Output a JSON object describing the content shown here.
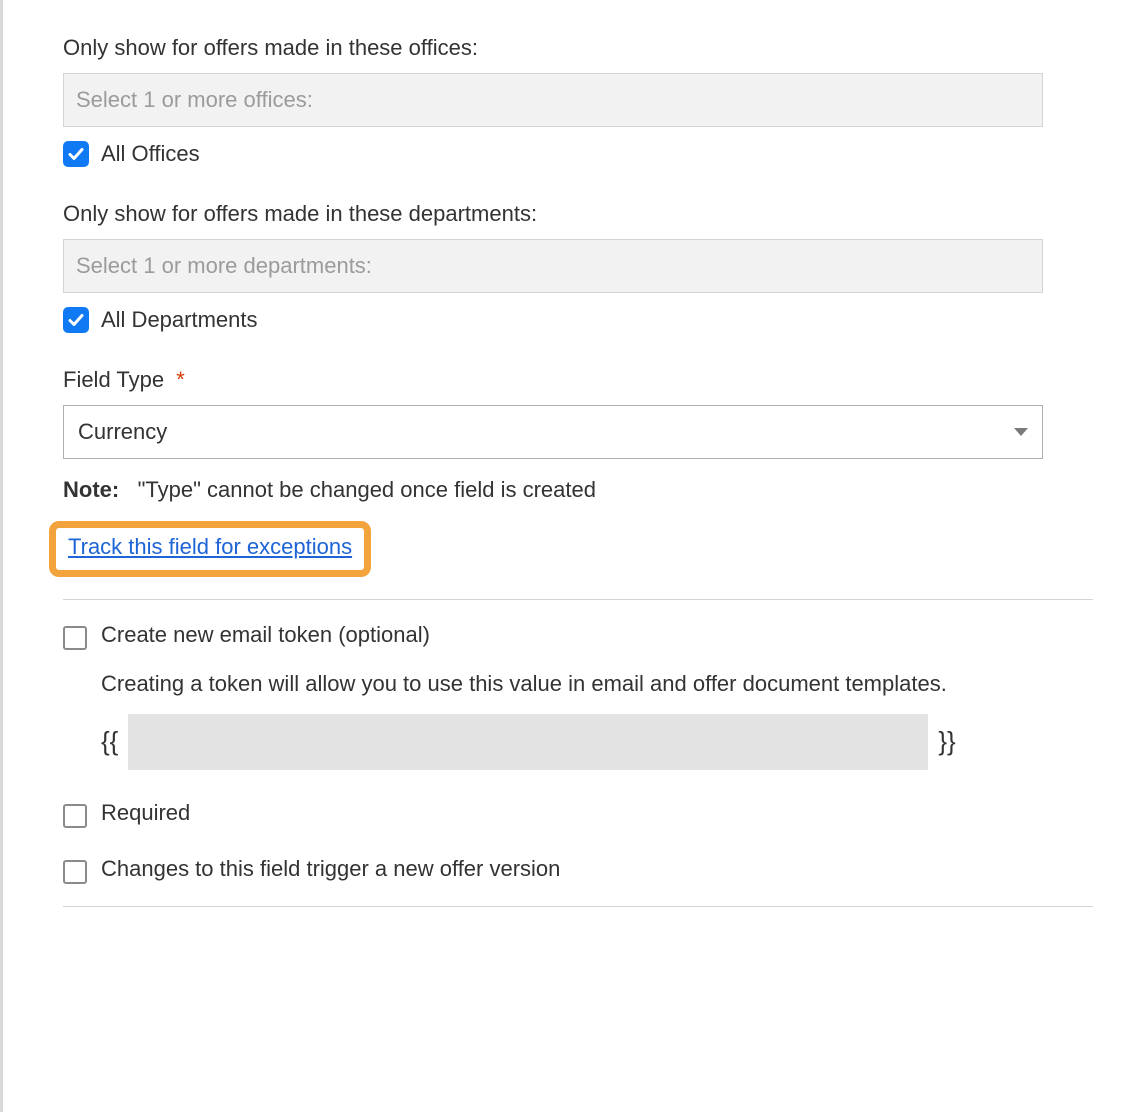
{
  "offices": {
    "label": "Only show for offers made in these offices:",
    "placeholder": "Select 1 or more offices:",
    "all_checked": true,
    "all_label": "All Offices"
  },
  "departments": {
    "label": "Only show for offers made in these departments:",
    "placeholder": "Select 1 or more departments:",
    "all_checked": true,
    "all_label": "All Departments"
  },
  "field_type": {
    "label": "Field Type",
    "required_mark": "*",
    "value": "Currency"
  },
  "note": {
    "prefix": "Note:",
    "text": "\"Type\" cannot be changed once field is created"
  },
  "track_link": "Track this field for exceptions",
  "token": {
    "checkbox_label": "Create new email token (optional)",
    "help": "Creating a token will allow you to use this value in email and offer document templates.",
    "open": "{{",
    "close": "}}",
    "value": ""
  },
  "required_option": "Required",
  "trigger_option": "Changes to this field trigger a new offer version"
}
